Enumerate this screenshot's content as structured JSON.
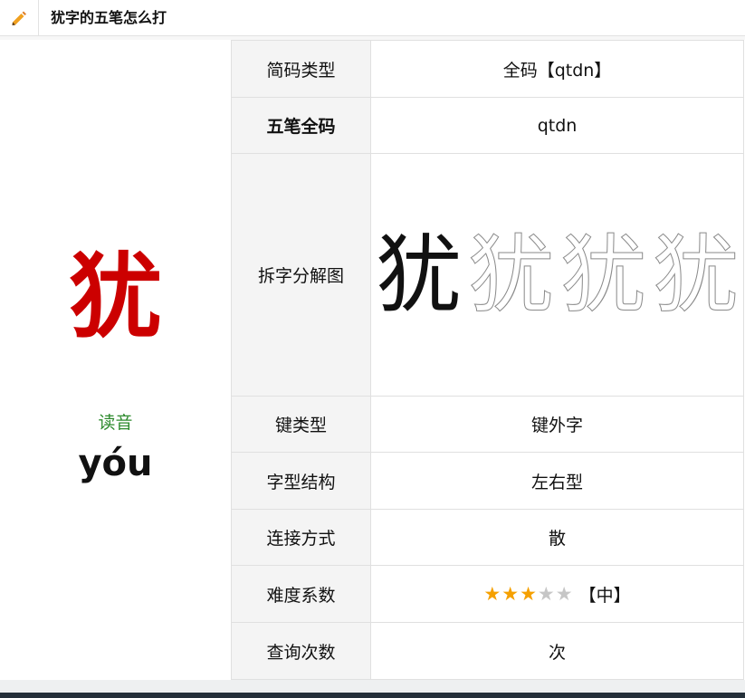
{
  "header": {
    "title": "犹字的五笔怎么打"
  },
  "left": {
    "character": "犹",
    "reading_label": "读音",
    "pinyin": "yóu"
  },
  "rows": [
    {
      "key": "简码类型",
      "value": "全码【qtdn】"
    },
    {
      "key": "五笔全码",
      "value": "qtdn"
    },
    {
      "key": "拆字分解图",
      "value": ""
    },
    {
      "key": "键类型",
      "value": "键外字"
    },
    {
      "key": "字型结构",
      "value": "左右型"
    },
    {
      "key": "连接方式",
      "value": "散"
    },
    {
      "key": "难度系数",
      "value": "【中】"
    },
    {
      "key": "查询次数",
      "value": "次"
    }
  ],
  "decomposition": {
    "glyphs": [
      "犹",
      "犹",
      "犹",
      "犹"
    ]
  },
  "difficulty": {
    "rating": 3,
    "max": 5
  },
  "colors": {
    "character": "#cc0000",
    "reading_label": "#2e8b2e",
    "star_on": "#f5a000",
    "star_off": "#c6c6c6",
    "header_icon": "#f0a020"
  },
  "icons": {
    "header": "pencil-icon"
  }
}
